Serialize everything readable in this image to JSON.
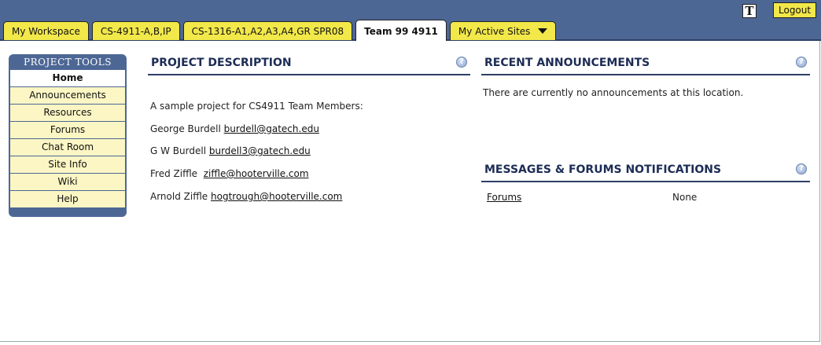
{
  "top_bar": {
    "tabs": [
      {
        "label": "My Workspace"
      },
      {
        "label": "CS-4911-A,B,IP"
      },
      {
        "label": "CS-1316-A1,A2,A3,A4,GR SPR08"
      },
      {
        "label": "Team 99 4911"
      },
      {
        "label": "My Active Sites"
      }
    ],
    "text_size_icon": "T",
    "logout_label": "Logout"
  },
  "tools_menu": {
    "title": "PROJECT TOOLS",
    "items": [
      {
        "label": "Home"
      },
      {
        "label": "Announcements"
      },
      {
        "label": "Resources"
      },
      {
        "label": "Forums"
      },
      {
        "label": "Chat Room"
      },
      {
        "label": "Site Info"
      },
      {
        "label": "Wiki"
      },
      {
        "label": "Help"
      }
    ]
  },
  "project_description": {
    "title": "PROJECT DESCRIPTION",
    "intro": "A sample project for CS4911 Team Members:",
    "members": [
      {
        "name": "George Burdell",
        "email": "burdell@gatech.edu"
      },
      {
        "name": "G W Burdell",
        "email": "burdell3@gatech.edu"
      },
      {
        "name": "Fred Ziffle ",
        "email": "ziffle@hooterville.com"
      },
      {
        "name": "Arnold Ziffle",
        "email": "hogtrough@hooterville.com"
      }
    ]
  },
  "announcements": {
    "title": "RECENT ANNOUNCEMENTS",
    "empty_text": "There are currently no announcements at this location."
  },
  "notifications": {
    "title": "MESSAGES & FORUMS NOTIFICATIONS",
    "rows": [
      {
        "label": "Forums",
        "value": "None"
      }
    ]
  },
  "help_icon_glyph": "?",
  "colors": {
    "header_blue": "#4d6795",
    "tab_yellow": "#f2e84a",
    "menu_item_bg": "#fbf6c4",
    "title_navy": "#1c2c55"
  }
}
